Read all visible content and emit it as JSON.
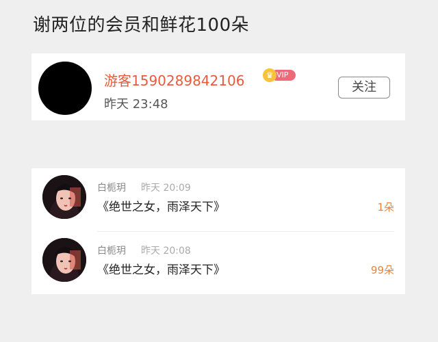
{
  "page": {
    "title": "谢两位的会员和鲜花100朵"
  },
  "profile": {
    "name": "游客1590289842106",
    "vip_label": "VIP",
    "time": "昨天  23:48",
    "follow_label": "关注"
  },
  "gifts": [
    {
      "user": "白栀玥",
      "time": "昨天  20:09",
      "book": "《绝世之女，雨泽天下》",
      "count": "1朵"
    },
    {
      "user": "白栀玥",
      "time": "昨天  20:08",
      "book": "《绝世之女，雨泽天下》",
      "count": "99朵"
    }
  ],
  "colors": {
    "accent": "#e85b3a",
    "count": "#e8843a",
    "vip": "#ef6a78",
    "crown": "#f7c33b"
  },
  "icons": {
    "crown": "crown-icon",
    "avatar": "avatar"
  }
}
